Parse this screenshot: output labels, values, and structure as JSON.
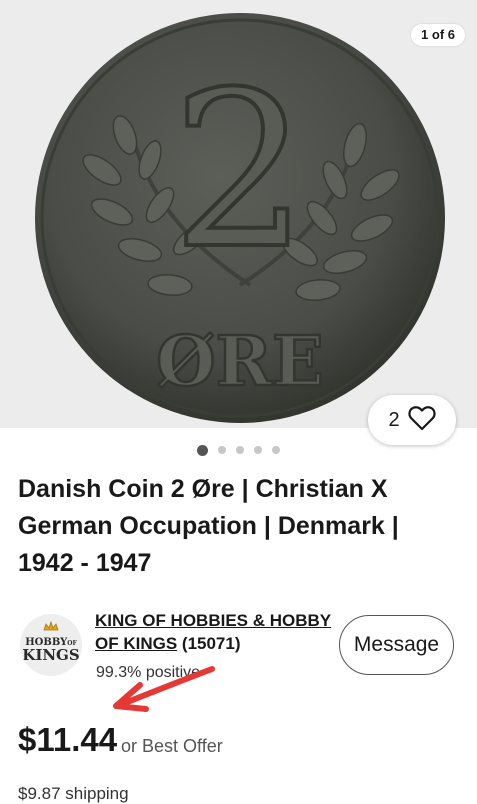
{
  "gallery": {
    "counter": "1 of 6",
    "coin": {
      "numeral": "2",
      "legend": "ØRE"
    },
    "watch_count": "2",
    "dots_total": 5,
    "dots_active": 1
  },
  "listing": {
    "title": "Danish Coin 2 Øre | Christian X German Occupation | Denmark | 1942 - 1947"
  },
  "seller": {
    "logo_top": "HOBBY",
    "logo_of": "OF",
    "logo_bottom": "KINGS",
    "name": "KING OF HOBBIES & HOBBY OF KINGS",
    "feedback_count": "(15071)",
    "positive": "99.3% positive",
    "message_label": "Message"
  },
  "pricing": {
    "price": "$11.44",
    "best_offer": "or Best Offer",
    "shipping": "$9.87 shipping"
  },
  "colors": {
    "arrow": "#e53935",
    "coin": "#4a4d47"
  }
}
